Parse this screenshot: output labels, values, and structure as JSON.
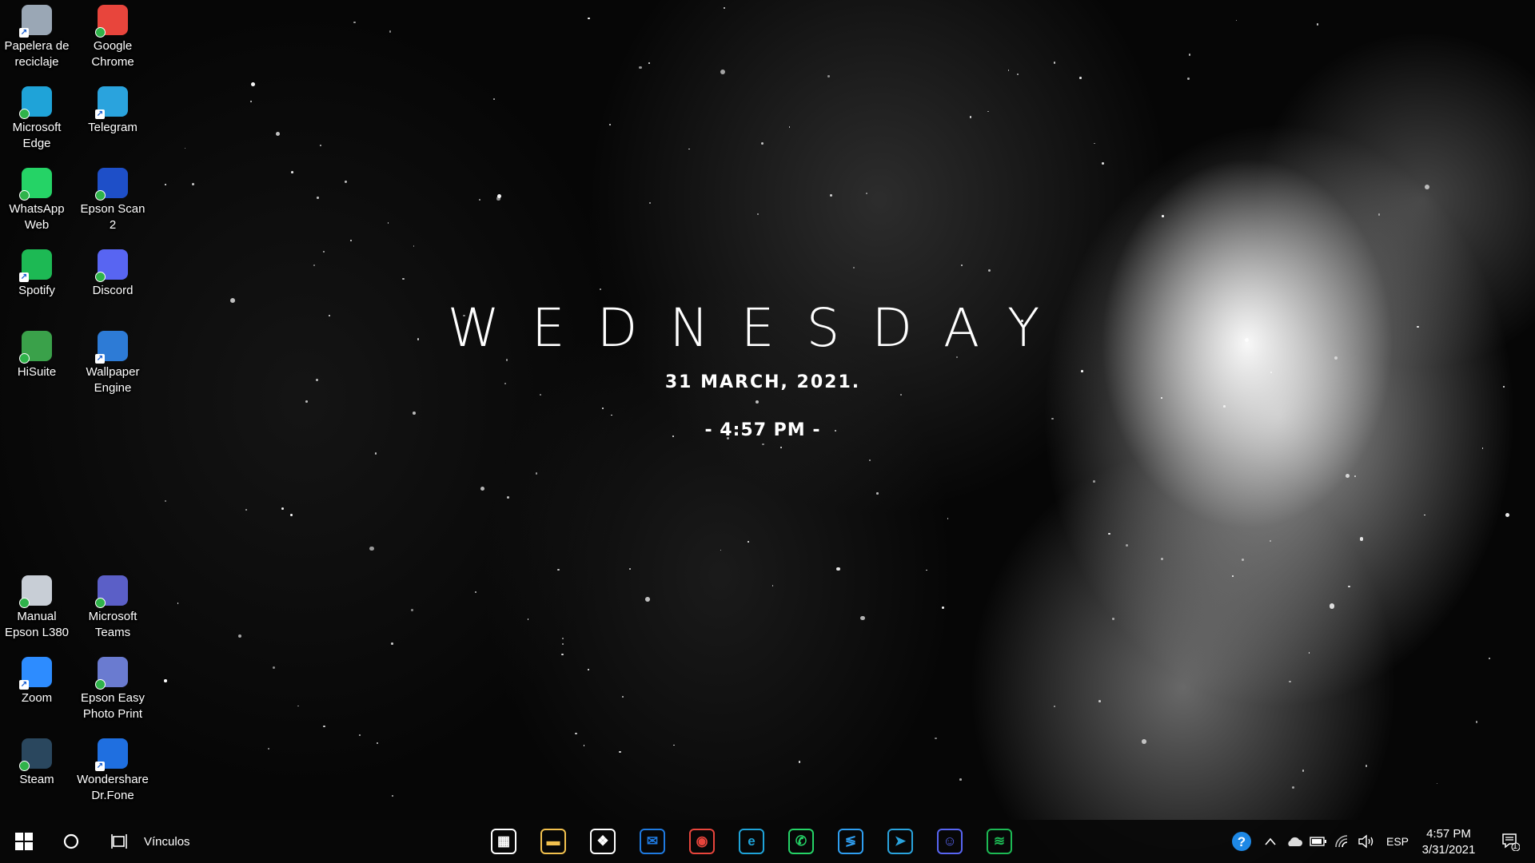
{
  "desktop_icons": [
    {
      "label": "Papelera de reciclaje",
      "icon": "recycle-bin-icon",
      "color": "#9aa7b5"
    },
    {
      "label": "Google Chrome",
      "icon": "chrome-icon",
      "color": "#e8453c"
    },
    {
      "label": "Microsoft Edge",
      "icon": "edge-icon",
      "color": "#1fa3d8"
    },
    {
      "label": "Telegram",
      "icon": "telegram-icon",
      "color": "#2aa3dd"
    },
    {
      "label": "WhatsApp Web",
      "icon": "whatsapp-icon",
      "color": "#25d366"
    },
    {
      "label": "Epson Scan 2",
      "icon": "epson-scan-icon",
      "color": "#1e4fc8"
    },
    {
      "label": "Spotify",
      "icon": "spotify-icon",
      "color": "#1db954"
    },
    {
      "label": "Discord",
      "icon": "discord-icon",
      "color": "#5865f2"
    },
    {
      "label": "HiSuite",
      "icon": "hisuite-icon",
      "color": "#3aa14a"
    },
    {
      "label": "Wallpaper Engine",
      "icon": "wallpaper-engine-icon",
      "color": "#2d7bd6"
    },
    {
      "label": "Manual Epson L380",
      "icon": "manual-icon",
      "color": "#c8ced6"
    },
    {
      "label": "Microsoft Teams",
      "icon": "teams-icon",
      "color": "#5b5fc7"
    },
    {
      "label": "Zoom",
      "icon": "zoom-icon",
      "color": "#2d8cff"
    },
    {
      "label": "Epson Easy Photo Print",
      "icon": "epson-photo-icon",
      "color": "#6a7bd0"
    },
    {
      "label": "Steam",
      "icon": "steam-icon",
      "color": "#2a475e"
    },
    {
      "label": "Wondershare Dr.Fone",
      "icon": "drfone-icon",
      "color": "#1f6fe0"
    }
  ],
  "widget": {
    "day": "WEDNESDAY",
    "date": "31 MARCH, 2021.",
    "time": "- 4:57 PM -"
  },
  "taskbar": {
    "search_label": "Vínculos",
    "apps": [
      {
        "name": "microsoft-store",
        "color": "#ffffff",
        "glyph": "▦"
      },
      {
        "name": "file-explorer",
        "color": "#f2c14e",
        "glyph": "▬"
      },
      {
        "name": "dropbox",
        "color": "#ffffff",
        "glyph": "❖"
      },
      {
        "name": "mail",
        "color": "#1f7ae0",
        "glyph": "✉"
      },
      {
        "name": "chrome",
        "color": "#e8453c",
        "glyph": "◉"
      },
      {
        "name": "edge",
        "color": "#1fa3d8",
        "glyph": "e"
      },
      {
        "name": "whatsapp",
        "color": "#25d366",
        "glyph": "✆"
      },
      {
        "name": "visual-studio-code",
        "color": "#2f9ef0",
        "glyph": "≶"
      },
      {
        "name": "telegram",
        "color": "#2aa3dd",
        "glyph": "➤"
      },
      {
        "name": "discord",
        "color": "#5865f2",
        "glyph": "☺"
      },
      {
        "name": "spotify",
        "color": "#1db954",
        "glyph": "≋"
      }
    ],
    "language": "ESP",
    "time": "4:57 PM",
    "date": "3/31/2021",
    "notification_count": "1"
  }
}
